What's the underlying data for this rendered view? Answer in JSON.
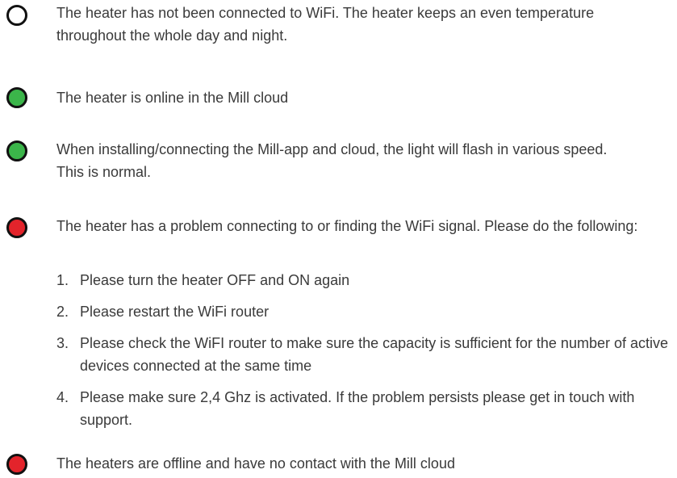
{
  "colors": {
    "outline_indicator": "#ffffff",
    "green_indicator": "#3bb54a",
    "red_indicator": "#e3242b"
  },
  "statuses": [
    {
      "indicator": "white-outline-circle-icon",
      "text": "The heater has not been connected to WiFi. The heater keeps an even temperature throughout the whole day and night."
    },
    {
      "indicator": "green-circle-icon",
      "text": "The heater is online in the Mill cloud"
    },
    {
      "indicator": "green-circle-icon",
      "text": "When installing/connecting the Mill-app and cloud, the light will flash in various speed. This is normal."
    },
    {
      "indicator": "red-circle-icon",
      "text": "The heater has a problem connecting to or finding the WiFi signal. Please do the following:",
      "steps": [
        {
          "num": "1.",
          "text": "Please turn the heater OFF and ON again"
        },
        {
          "num": "2.",
          "text": "Please restart the WiFi router"
        },
        {
          "num": "3.",
          "text": "Please check the WiFI router to make sure the capacity is sufficient for the number of active devices connected at the same time"
        },
        {
          "num": "4.",
          "text": "Please make sure 2,4 Ghz is activated. If the problem persists please get in touch with support."
        }
      ]
    },
    {
      "indicator": "red-circle-icon",
      "text": "The heaters are offline and have no contact with the Mill cloud"
    }
  ]
}
